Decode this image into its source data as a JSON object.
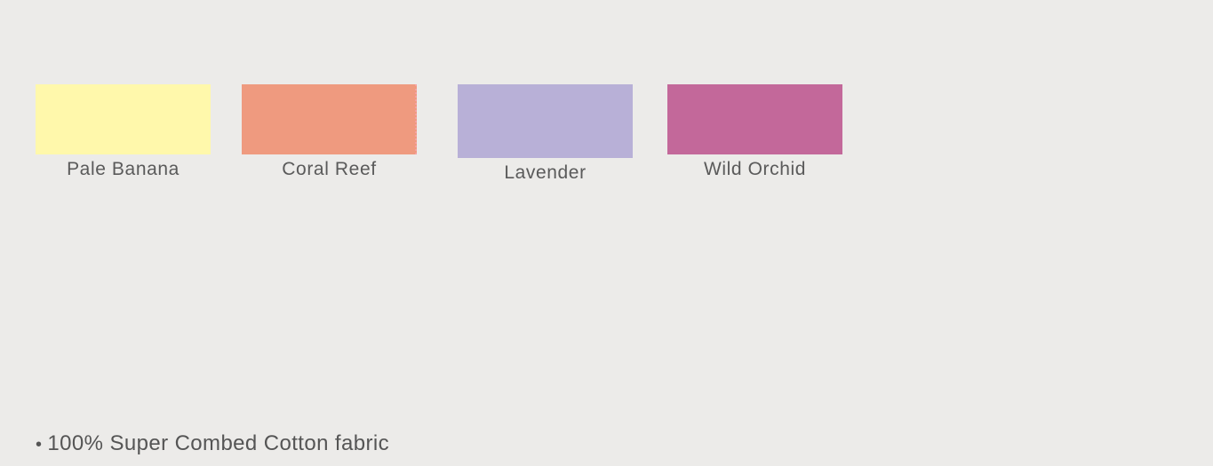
{
  "swatches": [
    {
      "label": "Pale Banana",
      "color": "#fff8ab"
    },
    {
      "label": "Coral Reef",
      "color": "#ef9a7f"
    },
    {
      "label": "Lavender",
      "color": "#b8b0d7"
    },
    {
      "label": "Wild Orchid",
      "color": "#c3689a"
    }
  ],
  "features": [
    {
      "bullet": "•",
      "text": "100% Super Combed Cotton fabric"
    }
  ]
}
